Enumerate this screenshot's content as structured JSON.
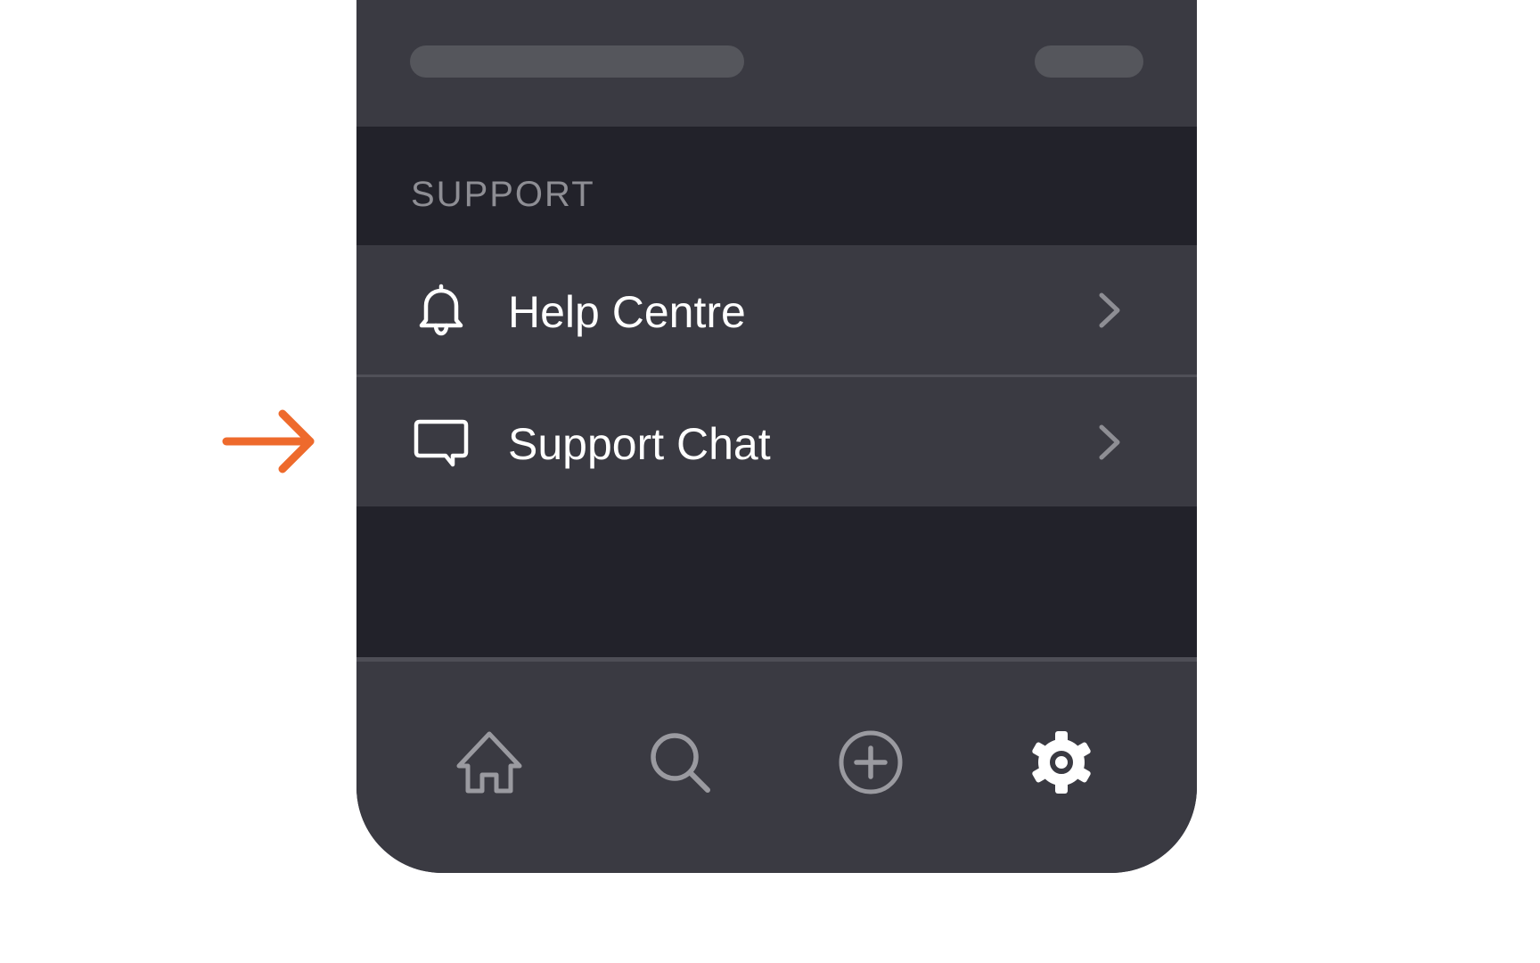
{
  "section": {
    "title": "SUPPORT"
  },
  "rows": [
    {
      "label": "Help Centre",
      "icon": "bell-icon"
    },
    {
      "label": "Support Chat",
      "icon": "chat-bubble-icon"
    }
  ],
  "tab_bar": {
    "tabs": [
      {
        "icon": "home-icon",
        "active": false
      },
      {
        "icon": "search-icon",
        "active": false
      },
      {
        "icon": "plus-circle-icon",
        "active": false
      },
      {
        "icon": "gear-icon",
        "active": true
      }
    ]
  },
  "annotation": {
    "icon": "arrow-right-icon",
    "color": "#ee6a2c",
    "points_to": "Support Chat"
  },
  "colors": {
    "surface": "#3a3a42",
    "section_background": "#22222a",
    "placeholder": "#55565c",
    "muted_text": "#8e8e94",
    "inactive_icon": "#9a9aa0",
    "active_icon": "#ffffff"
  }
}
